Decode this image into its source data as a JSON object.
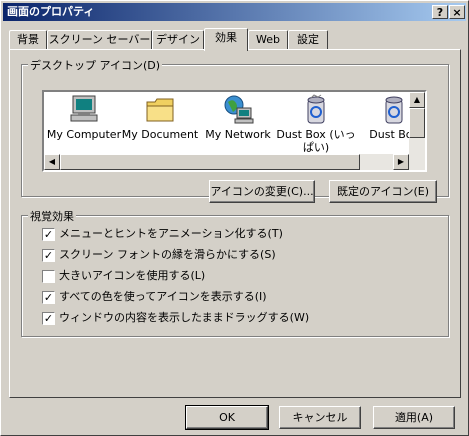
{
  "window": {
    "title": "画面のプロパティ",
    "help_btn": "?",
    "close_btn": "×"
  },
  "tabs": [
    {
      "label": "背景"
    },
    {
      "label": "スクリーン セーバー"
    },
    {
      "label": "デザイン"
    },
    {
      "label": "効果"
    },
    {
      "label": "Web"
    },
    {
      "label": "設定"
    }
  ],
  "desktop_icons": {
    "group_label": "デスクトップ アイコン(D)",
    "items": [
      {
        "label": "My Computer",
        "icon": "computer-icon"
      },
      {
        "label": "My Document",
        "icon": "folder-icon"
      },
      {
        "label": "My Network",
        "icon": "network-icon"
      },
      {
        "label": "Dust Box (いっぱい)",
        "icon": "full-recycle-bin-icon"
      },
      {
        "label": "Dust Box",
        "icon": "recycle-bin-icon"
      }
    ],
    "change_icon_btn": "アイコンの変更(C)...",
    "default_icon_btn": "既定のアイコン(E)"
  },
  "visual_effects": {
    "group_label": "視覚効果",
    "options": [
      {
        "label": "メニューとヒントをアニメーション化する(T)",
        "checked": true
      },
      {
        "label": "スクリーン フォントの縁を滑らかにする(S)",
        "checked": true
      },
      {
        "label": "大きいアイコンを使用する(L)",
        "checked": false
      },
      {
        "label": "すべての色を使ってアイコンを表示する(I)",
        "checked": true
      },
      {
        "label": "ウィンドウの内容を表示したままドラッグする(W)",
        "checked": true
      }
    ]
  },
  "footer": {
    "ok": "OK",
    "cancel": "キャンセル",
    "apply": "適用(A)"
  }
}
